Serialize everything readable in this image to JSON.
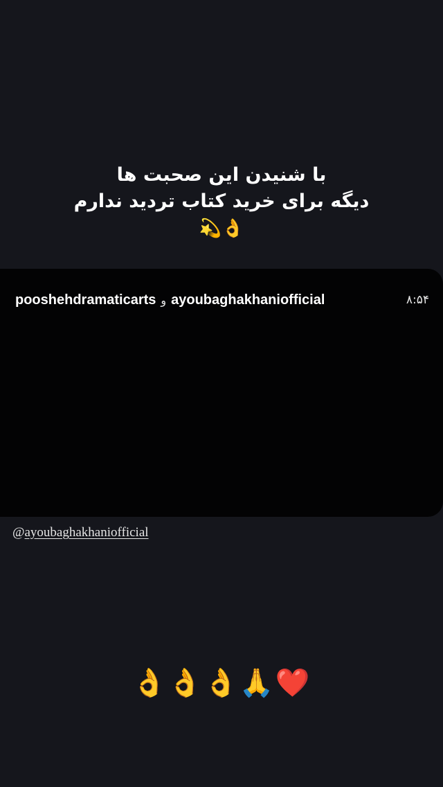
{
  "caption": {
    "line1": "با شنیدن این صحبت ها",
    "line2": "دیگه برای خرید کتاب تردید ندارم",
    "emoji": "👌💫"
  },
  "video_card": {
    "account_1": "pooshehdramaticarts",
    "conjunction": "و",
    "account_2": "ayoubaghakhaniofficial",
    "duration": "۸:۵۴"
  },
  "mention": {
    "at": "@",
    "handle": "ayoubaghakhaniofficial"
  },
  "reaction_emojis": "👌👌👌🙏❤️"
}
